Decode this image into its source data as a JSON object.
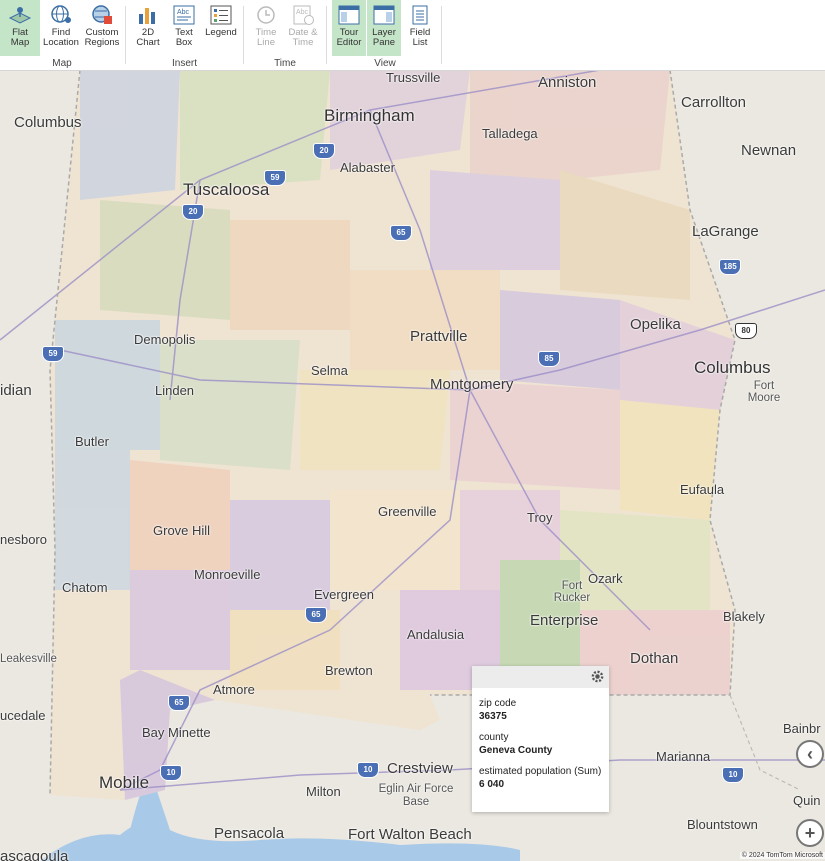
{
  "ribbon": {
    "map_group": {
      "label": "Map",
      "flat_map": "Flat Map",
      "find_location": "Find Location",
      "custom_regions": "Custom Regions"
    },
    "insert_group": {
      "label": "Insert",
      "chart_2d": "2D Chart",
      "text_box": "Text Box",
      "legend": "Legend"
    },
    "time_group": {
      "label": "Time",
      "time_line": "Time Line",
      "date_time": "Date & Time"
    },
    "view_group": {
      "label": "View",
      "tour_editor": "Tour Editor",
      "layer_pane": "Layer Pane",
      "field_list": "Field List"
    }
  },
  "cities": {
    "anniston": "Anniston",
    "trussville": "Trussville",
    "birmingham": "Birmingham",
    "carrollton": "Carrollton",
    "columbus_ms": "Columbus",
    "talladega": "Talladega",
    "newnan": "Newnan",
    "alabaster": "Alabaster",
    "tuscaloosa": "Tuscaloosa",
    "lagrange": "LaGrange",
    "demopolis": "Demopolis",
    "prattville": "Prattville",
    "opelika": "Opelika",
    "selma": "Selma",
    "montgomery": "Montgomery",
    "columbus_ga": "Columbus",
    "fort_moore": "Fort Moore",
    "meridian": "idian",
    "linden": "Linden",
    "butler": "Butler",
    "eufaula": "Eufaula",
    "greenville": "Greenville",
    "troy": "Troy",
    "waynesboro": "nesboro",
    "grove_hill": "Grove Hill",
    "chatom": "Chatom",
    "monroeville": "Monroeville",
    "ozark": "Ozark",
    "fort_rucker": "Fort Rucker",
    "evergreen": "Evergreen",
    "blakely": "Blakely",
    "enterprise": "Enterprise",
    "andalusia": "Andalusia",
    "leakesville": "Leakesville",
    "dothan": "Dothan",
    "brewton": "Brewton",
    "atmore": "Atmore",
    "lucedale": "ucedale",
    "bay_minette": "Bay Minette",
    "bainbridge": "Bainbr",
    "marianna": "Marianna",
    "crestview": "Crestview",
    "mobile": "Mobile",
    "milton": "Milton",
    "eglin": "Eglin Air Force Base",
    "quincy": "Quin",
    "blountstown": "Blountstown",
    "pensacola": "Pensacola",
    "fort_walton": "Fort Walton Beach",
    "pascagoula": "ascagoula"
  },
  "highways": [
    "20",
    "59",
    "20",
    "65",
    "185",
    "59",
    "85",
    "80",
    "65",
    "65",
    "10",
    "10",
    "10"
  ],
  "tooltip": {
    "zip_label": "zip code",
    "zip_value": "36375",
    "county_label": "county",
    "county_value": "Geneva County",
    "pop_label": "estimated population (Sum)",
    "pop_value": "6 040"
  },
  "copyright": "© 2024 TomTom  Microsoft",
  "colors": {
    "active_button": "#c5e5c9",
    "water": "#a9c9e8",
    "tooltip_header": "#ececec"
  }
}
